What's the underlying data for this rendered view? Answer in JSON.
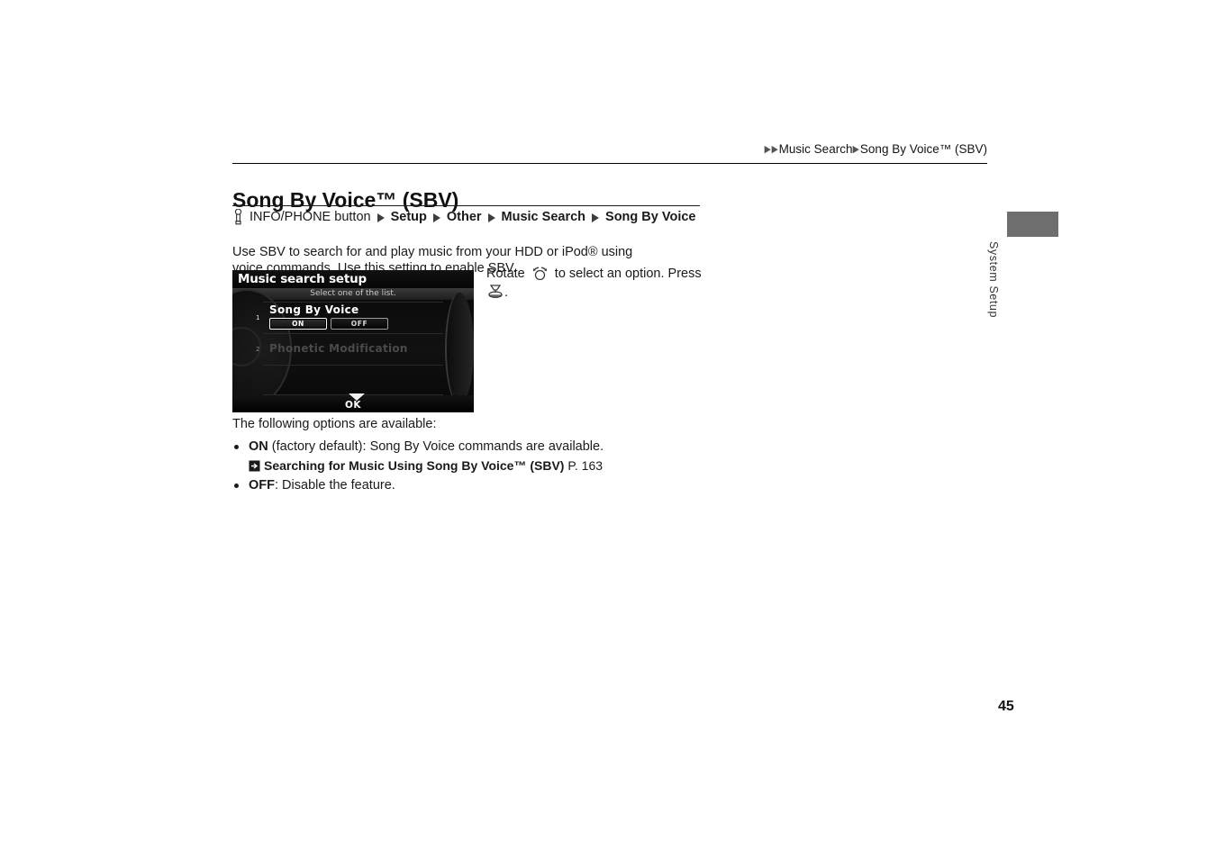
{
  "header": {
    "breadcrumb_arrow": "▶",
    "breadcrumb_parts": [
      "Music Search",
      "Song By Voice™ (SBV)"
    ]
  },
  "title": "Song By Voice™ (SBV)",
  "path": {
    "button_icon": "hand-press-icon",
    "button_label": "INFO/PHONE button",
    "steps": [
      "Setup",
      "Other",
      "Music Search",
      "Song By Voice"
    ],
    "separator": "▶"
  },
  "intro": "Use SBV to search for and play music from your HDD or iPod® using voice commands. Use this setting to enable SBV.",
  "device": {
    "title": "Music search setup",
    "subtitle": "Select one of the list.",
    "rows": [
      {
        "number": "1",
        "label": "Song By Voice",
        "dimmed": false,
        "buttons": [
          {
            "label": "ON",
            "selected": true
          },
          {
            "label": "OFF",
            "selected": false
          }
        ]
      },
      {
        "number": "2",
        "label": "Phonetic Modification",
        "dimmed": true,
        "buttons": []
      }
    ],
    "ok_label": "OK",
    "scroll_icon": "triangle-down-icon"
  },
  "instruction": {
    "text_before": "Rotate",
    "rotate_icon": "rotary-dial-icon",
    "text_middle": "to select an option. Press",
    "press_icon": "press-knob-icon",
    "text_after": "."
  },
  "options": {
    "intro": "The following options are available:",
    "items": [
      {
        "bold": "ON",
        "rest": " (factory default): Song By Voice commands are available.",
        "xref": {
          "icon": "jump-arrow-icon",
          "label": "Searching for Music Using Song By Voice™ (SBV)",
          "page": "P. 163"
        }
      },
      {
        "bold": "OFF",
        "rest": ": Disable the feature.",
        "xref": null
      }
    ]
  },
  "side_tab": {
    "label": "System Setup",
    "color": "#6e6e6e"
  },
  "page_number": "45"
}
